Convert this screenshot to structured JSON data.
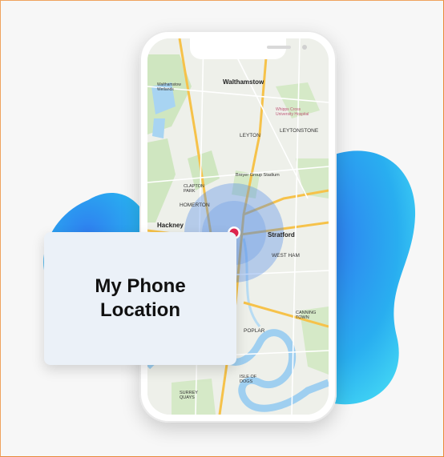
{
  "card": {
    "title": "My Phone Location"
  },
  "map": {
    "labels": {
      "walthamstow": "Walthamstow",
      "wetlands": "Walthamstow Wetlands",
      "hospital": "Whipps Cross University Hospital",
      "leyton": "LEYTON",
      "leytonstone": "LEYTONSTONE",
      "stadium": "Breyer Group Stadium",
      "clapton": "CLAPTON PARK",
      "homerton": "HOMERTON",
      "hackney": "Hackney",
      "stratford": "Stratford",
      "westham": "WEST HAM",
      "poplar": "POPLAR",
      "canningtown": "CANNING TOWN",
      "isle": "ISLE OF DOGS",
      "surrey": "SURREY QUAYS"
    }
  },
  "colors": {
    "accent_blob": "#35c6f0",
    "pin": "#e0254f",
    "card_bg": "#ebf1f8",
    "frame_border": "#e8893a"
  },
  "icons": [
    "location-pin-icon"
  ]
}
